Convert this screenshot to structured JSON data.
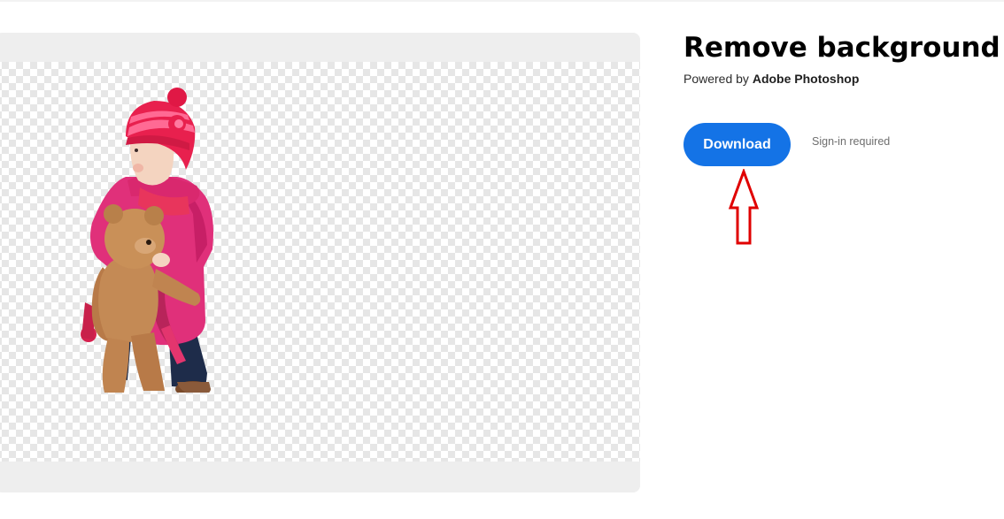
{
  "header": {
    "title": "Remove background",
    "powered_prefix": "Powered by ",
    "powered_brand": "Adobe Photoshop"
  },
  "actions": {
    "download_label": "Download",
    "signin_note": "Sign-in required"
  },
  "preview": {
    "image_subject": "child with teddy bear on transparent background"
  },
  "icons": {
    "annotation": "up-arrow-icon"
  },
  "colors": {
    "accent": "#1473e6",
    "annotation_arrow": "#e00000",
    "frame": "#eeeeee"
  }
}
